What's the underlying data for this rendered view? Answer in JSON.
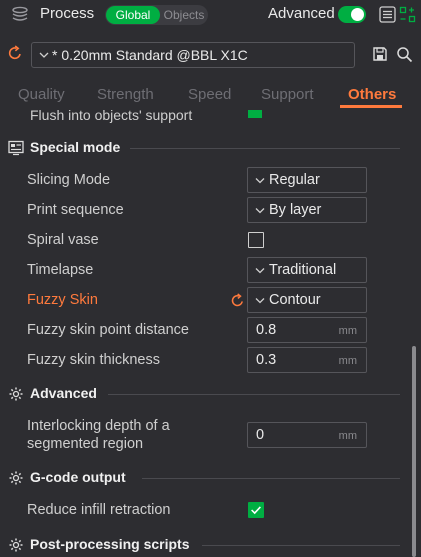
{
  "header": {
    "title": "Process",
    "seg_global": "Global",
    "seg_objects": "Objects",
    "advanced_label": "Advanced",
    "advanced_on": true
  },
  "preset": {
    "name": "* 0.20mm Standard @BBL X1C"
  },
  "tabs": [
    {
      "label": "Quality",
      "active": false
    },
    {
      "label": "Strength",
      "active": false
    },
    {
      "label": "Speed",
      "active": false
    },
    {
      "label": "Support",
      "active": false
    },
    {
      "label": "Others",
      "active": true
    }
  ],
  "cut_row": {
    "label": "Flush into objects' support",
    "checked": true
  },
  "sections": {
    "special_mode": "Special mode",
    "advanced": "Advanced",
    "gcode_output": "G-code output",
    "post_processing": "Post-processing scripts"
  },
  "rows": {
    "slicing_mode": {
      "label": "Slicing Mode",
      "value": "Regular"
    },
    "print_sequence": {
      "label": "Print sequence",
      "value": "By layer"
    },
    "spiral_vase": {
      "label": "Spiral vase",
      "checked": false
    },
    "timelapse": {
      "label": "Timelapse",
      "value": "Traditional"
    },
    "fuzzy_skin": {
      "label": "Fuzzy Skin",
      "value": "Contour"
    },
    "fuzzy_point_distance": {
      "label": "Fuzzy skin point distance",
      "value": "0.8",
      "unit": "mm"
    },
    "fuzzy_thickness": {
      "label": "Fuzzy skin thickness",
      "value": "0.3",
      "unit": "mm"
    },
    "interlocking_line1": "Interlocking depth of a",
    "interlocking_line2": "segmented region",
    "interlocking_value": "0",
    "interlocking_unit": "mm",
    "reduce_infill": {
      "label": "Reduce infill retraction",
      "checked": true
    }
  },
  "colors": {
    "accent_green": "#00ae42",
    "accent_orange": "#ff7a3d",
    "background": "#2d2d31"
  }
}
